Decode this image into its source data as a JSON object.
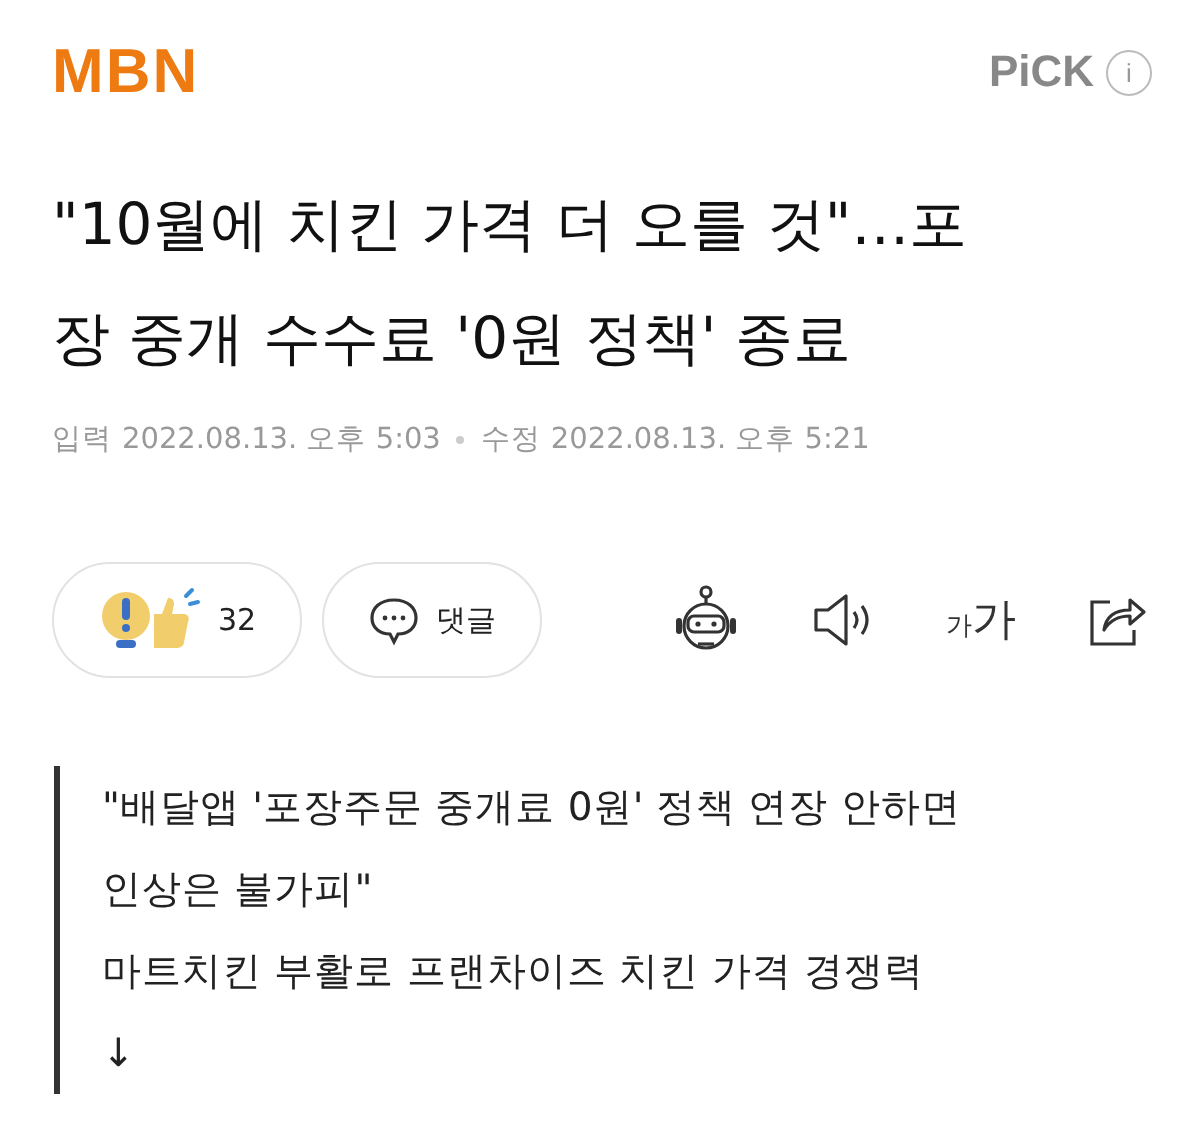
{
  "header": {
    "logo": "MBN",
    "badge": "PiCK",
    "info": "i"
  },
  "headline": {
    "lines": [
      "\"10월에 치킨 가격 더 오를 것\"…포",
      "장 중개 수수료 '0원 정책' 종료"
    ]
  },
  "dates": {
    "input_label": "입력",
    "input_time": "2022.08.13. 오후 5:03",
    "edit_label": "수정",
    "edit_time": "2022.08.13. 오후 5:21"
  },
  "actions": {
    "reaction_count": "32",
    "comment_label": "댓글",
    "font_small": "가",
    "font_large": "가"
  },
  "quote": {
    "lines": [
      "\"배달앱 '포장주문 중개료 0원' 정책 연장 안하면",
      "인상은 불가피\"",
      "마트치킨 부활로 프랜차이즈 치킨 가격 경쟁력",
      "↓"
    ]
  }
}
